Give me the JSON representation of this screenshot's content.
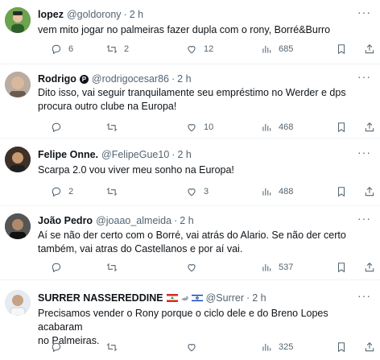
{
  "tweets": [
    {
      "name": "lopez",
      "handle": "@goldorony",
      "dot": "·",
      "time": "2 h",
      "text": [
        "vem mito jogar no palmeiras fazer dupla com o rony, Borré&Burro"
      ],
      "replies": "6",
      "retweets": "2",
      "likes": "12",
      "views": "685",
      "avatar_color": "#4f8a3c"
    },
    {
      "name": "Rodrigo",
      "badge": "P",
      "handle": "@rodrigocesar86",
      "dot": "·",
      "time": "2 h",
      "text": [
        "Dito isso, vai seguir tranquilamente seu empréstimo no Werder e dps",
        "procura outro clube na Europa!"
      ],
      "replies": "",
      "retweets": "",
      "likes": "10",
      "views": "468",
      "avatar_color": "#9a8a7c"
    },
    {
      "name": "Felipe Onne.",
      "handle": "@FelipeGue10",
      "dot": "·",
      "time": "2 h",
      "text": [
        "Scarpa 2.0 vou viver meu sonho na Europa!"
      ],
      "replies": "2",
      "retweets": "",
      "likes": "3",
      "views": "488",
      "avatar_color": "#5b4a3c"
    },
    {
      "name": "João Pedro",
      "handle": "@joaao_almeida",
      "dot": "·",
      "time": "2 h",
      "text": [
        "Aí se não der certo com o Borré, vai atrás do Alario. Se não der certo",
        "também, vai atras do Castellanos e por aí vai."
      ],
      "replies": "",
      "retweets": "",
      "likes": "",
      "views": "537",
      "avatar_color": "#3a3a3a"
    },
    {
      "name": "SURRER NASSEREDDINE",
      "flags": [
        "lebanon-flag",
        "dove",
        "israel-flag"
      ],
      "handle": "@Surrer",
      "dot": "·",
      "time": "2 h",
      "text": [
        "Precisamos vender o Rony porque o ciclo dele e do Breno Lopes acabaram",
        "no Palmeiras."
      ],
      "replies": "",
      "retweets": "",
      "likes": "",
      "views": "325",
      "avatar_color": "#dde3ea"
    }
  ]
}
